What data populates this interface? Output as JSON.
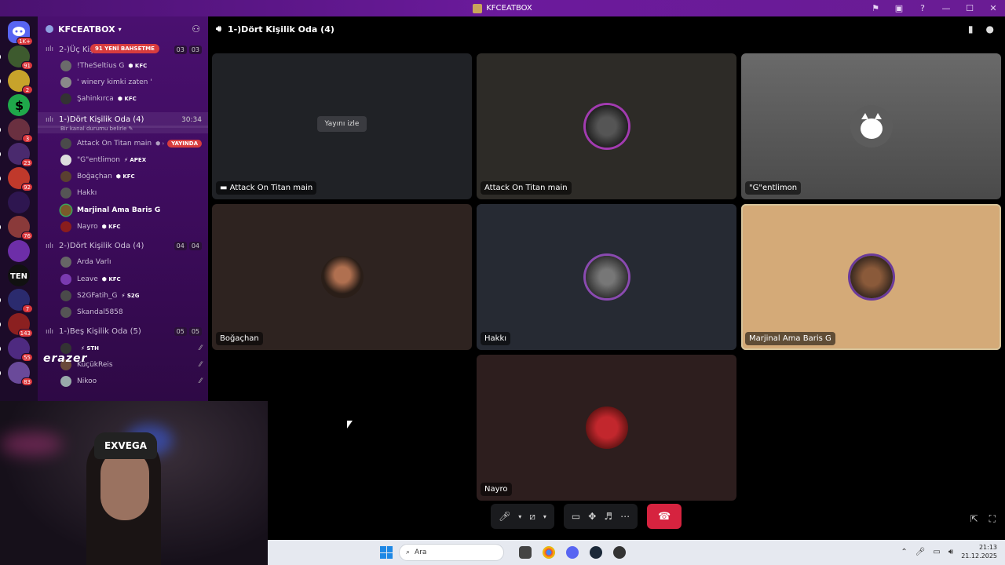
{
  "window": {
    "title": "KFCEATBOX"
  },
  "colors": {
    "accent": "#6b1a9c",
    "live": "#d83c3e",
    "hangup": "#d6233f",
    "speaking": "#d6c39a"
  },
  "rail": {
    "home_badge": "1K+",
    "badges": [
      "91",
      "2",
      "",
      "3",
      "23",
      "92",
      "",
      "76",
      "",
      "",
      "7",
      "143",
      "55",
      "83"
    ]
  },
  "sidebar": {
    "guild_name": "KFCEATBOX",
    "channels": [
      {
        "name": "2-)Üç Kişilik",
        "badge": "91 YENİ BAHSETME",
        "count_a": "03",
        "count_b": "03",
        "users": [
          {
            "name": "!TheSeltius G",
            "tag": "KFC"
          },
          {
            "name": "' winery kimki zaten '",
            "tag": ""
          },
          {
            "name": "Şahinkırca",
            "tag": "KFC"
          }
        ]
      },
      {
        "name": "1-)Dört Kişilik Oda (4)",
        "time": "30:34",
        "status": "Bir kanal durumu belirle",
        "users": [
          {
            "name": "Attack On Titan main",
            "tag": "",
            "live": "YAYINDA"
          },
          {
            "name": "\"G\"entlimon",
            "tag": "APEX"
          },
          {
            "name": "Boğaçhan",
            "tag": "KFC"
          },
          {
            "name": "Hakkı",
            "tag": ""
          },
          {
            "name": "Marjinal Ama Baris G",
            "tag": ""
          },
          {
            "name": "Nayro",
            "tag": "KFC"
          }
        ]
      },
      {
        "name": "2-)Dört Kişilik Oda (4)",
        "count_a": "04",
        "count_b": "04",
        "users": [
          {
            "name": "Arda Varlı",
            "tag": ""
          },
          {
            "name": "Leave",
            "tag": "KFC"
          },
          {
            "name": "S2GFatih_G",
            "tag": "S2G"
          },
          {
            "name": "Skandal5858",
            "tag": ""
          }
        ]
      },
      {
        "name": "1-)Beş Kişilik Oda (5)",
        "count_a": "05",
        "count_b": "05",
        "users": [
          {
            "name": "",
            "tag": "STH"
          },
          {
            "name": "KüçükReis",
            "tag": ""
          },
          {
            "name": "Nikoo",
            "tag": ""
          }
        ]
      }
    ]
  },
  "voice": {
    "channel_title": "1-)Dört Kişilik Oda (4)",
    "watch_label": "Yayını izle",
    "tiles": [
      {
        "name": "Attack On Titan main",
        "stream": true
      },
      {
        "name": "Attack On Titan main"
      },
      {
        "name": "\"G\"entlimon"
      },
      {
        "name": "Boğaçhan"
      },
      {
        "name": "Hakkı"
      },
      {
        "name": "Marjinal Ama Baris G",
        "speaking": true
      },
      {
        "name": "Nayro"
      }
    ]
  },
  "webcam": {
    "overlay_text": "erazer",
    "cap_text": "EXVEGA"
  },
  "taskbar": {
    "search_placeholder": "Ara",
    "time": "21:13",
    "date": "21.12.2025"
  }
}
